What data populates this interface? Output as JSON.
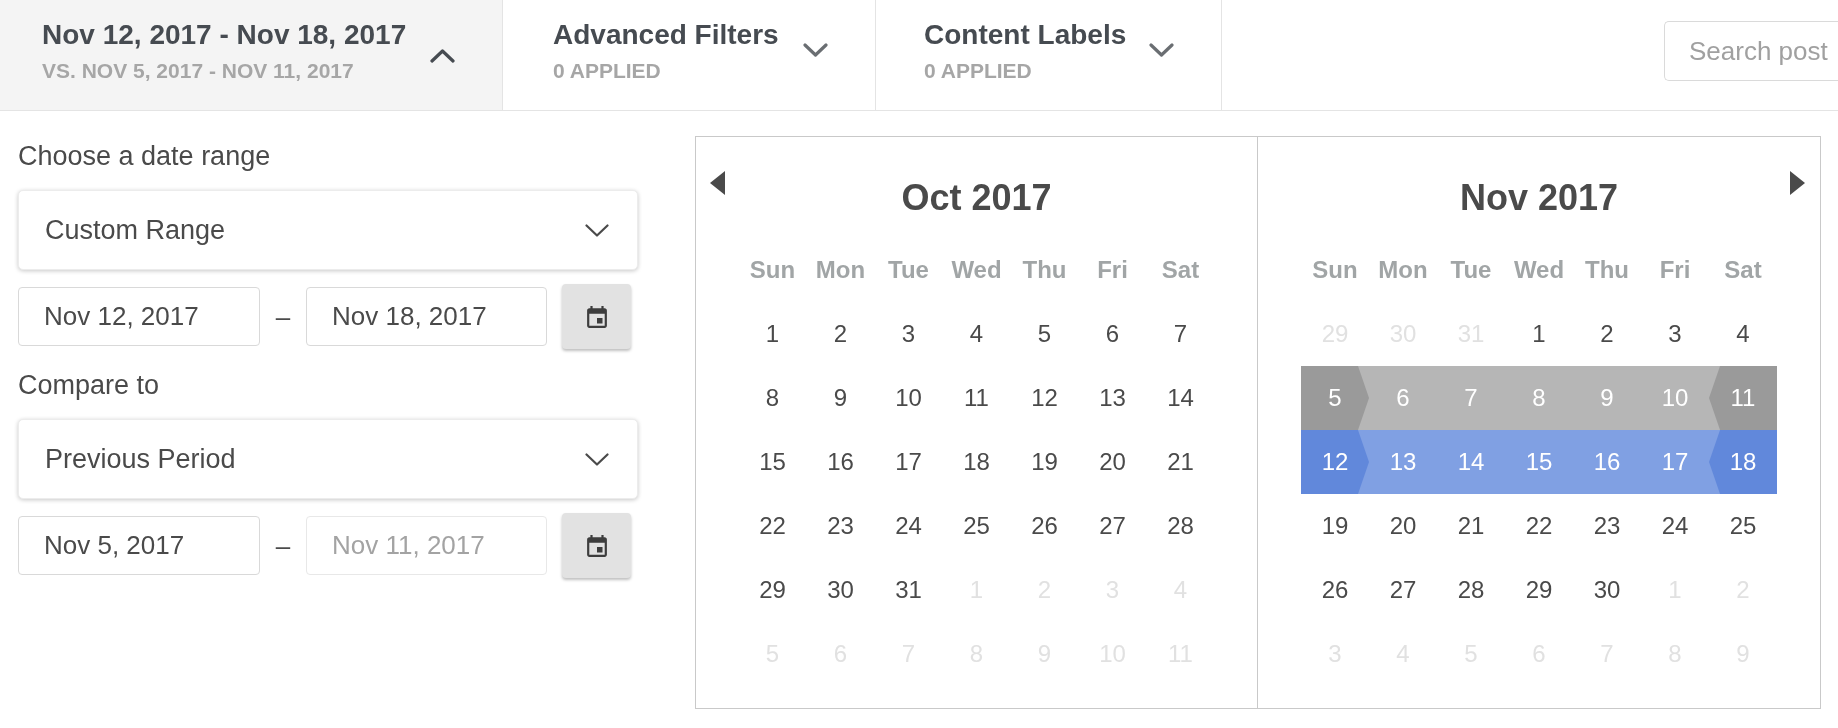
{
  "filter_bar": {
    "tabs": [
      {
        "title": "Nov 12, 2017 - Nov 18, 2017",
        "subtitle": "VS. NOV 5, 2017 - NOV 11, 2017",
        "expanded": true
      },
      {
        "title": "Advanced Filters",
        "subtitle": "0 APPLIED",
        "expanded": false
      },
      {
        "title": "Content Labels",
        "subtitle": "0 APPLIED",
        "expanded": false
      }
    ],
    "search": {
      "placeholder": "Search post"
    }
  },
  "date_panel": {
    "sections": [
      {
        "label": "Choose a date range",
        "dropdown": "Custom Range",
        "start": {
          "value": "Nov 12, 2017",
          "disabled": false
        },
        "separator": "–",
        "end": {
          "value": "Nov 18, 2017",
          "disabled": false
        }
      },
      {
        "label": "Compare to",
        "dropdown": "Previous Period",
        "start": {
          "value": "Nov 5, 2017",
          "disabled": false
        },
        "separator": "–",
        "end": {
          "value": "Nov 11, 2017",
          "disabled": true
        }
      }
    ]
  },
  "calendar": {
    "months": [
      {
        "title": "Oct 2017",
        "weekdays": [
          "Sun",
          "Mon",
          "Tue",
          "Wed",
          "Thu",
          "Fri",
          "Sat"
        ],
        "weeks": [
          [
            {
              "label": "1",
              "other_month": false,
              "selected": false,
              "compared": false
            },
            {
              "label": "2",
              "other_month": false,
              "selected": false,
              "compared": false
            },
            {
              "label": "3",
              "other_month": false,
              "selected": false,
              "compared": false
            },
            {
              "label": "4",
              "other_month": false,
              "selected": false,
              "compared": false
            },
            {
              "label": "5",
              "other_month": false,
              "selected": false,
              "compared": false
            },
            {
              "label": "6",
              "other_month": false,
              "selected": false,
              "compared": false
            },
            {
              "label": "7",
              "other_month": false,
              "selected": false,
              "compared": false
            }
          ],
          [
            {
              "label": "8",
              "other_month": false,
              "selected": false,
              "compared": false
            },
            {
              "label": "9",
              "other_month": false,
              "selected": false,
              "compared": false
            },
            {
              "label": "10",
              "other_month": false,
              "selected": false,
              "compared": false
            },
            {
              "label": "11",
              "other_month": false,
              "selected": false,
              "compared": false
            },
            {
              "label": "12",
              "other_month": false,
              "selected": false,
              "compared": false
            },
            {
              "label": "13",
              "other_month": false,
              "selected": false,
              "compared": false
            },
            {
              "label": "14",
              "other_month": false,
              "selected": false,
              "compared": false
            }
          ],
          [
            {
              "label": "15",
              "other_month": false,
              "selected": false,
              "compared": false
            },
            {
              "label": "16",
              "other_month": false,
              "selected": false,
              "compared": false
            },
            {
              "label": "17",
              "other_month": false,
              "selected": false,
              "compared": false
            },
            {
              "label": "18",
              "other_month": false,
              "selected": false,
              "compared": false
            },
            {
              "label": "19",
              "other_month": false,
              "selected": false,
              "compared": false
            },
            {
              "label": "20",
              "other_month": false,
              "selected": false,
              "compared": false
            },
            {
              "label": "21",
              "other_month": false,
              "selected": false,
              "compared": false
            }
          ],
          [
            {
              "label": "22",
              "other_month": false,
              "selected": false,
              "compared": false
            },
            {
              "label": "23",
              "other_month": false,
              "selected": false,
              "compared": false
            },
            {
              "label": "24",
              "other_month": false,
              "selected": false,
              "compared": false
            },
            {
              "label": "25",
              "other_month": false,
              "selected": false,
              "compared": false
            },
            {
              "label": "26",
              "other_month": false,
              "selected": false,
              "compared": false
            },
            {
              "label": "27",
              "other_month": false,
              "selected": false,
              "compared": false
            },
            {
              "label": "28",
              "other_month": false,
              "selected": false,
              "compared": false
            }
          ],
          [
            {
              "label": "29",
              "other_month": false,
              "selected": false,
              "compared": false
            },
            {
              "label": "30",
              "other_month": false,
              "selected": false,
              "compared": false
            },
            {
              "label": "31",
              "other_month": false,
              "selected": false,
              "compared": false
            },
            {
              "label": "1",
              "other_month": true,
              "selected": false,
              "compared": false
            },
            {
              "label": "2",
              "other_month": true,
              "selected": false,
              "compared": false
            },
            {
              "label": "3",
              "other_month": true,
              "selected": false,
              "compared": false
            },
            {
              "label": "4",
              "other_month": true,
              "selected": false,
              "compared": false
            }
          ],
          [
            {
              "label": "5",
              "other_month": true,
              "selected": false,
              "compared": false
            },
            {
              "label": "6",
              "other_month": true,
              "selected": false,
              "compared": false
            },
            {
              "label": "7",
              "other_month": true,
              "selected": false,
              "compared": false
            },
            {
              "label": "8",
              "other_month": true,
              "selected": false,
              "compared": false
            },
            {
              "label": "9",
              "other_month": true,
              "selected": false,
              "compared": false
            },
            {
              "label": "10",
              "other_month": true,
              "selected": false,
              "compared": false
            },
            {
              "label": "11",
              "other_month": true,
              "selected": false,
              "compared": false
            }
          ]
        ]
      },
      {
        "title": "Nov 2017",
        "weekdays": [
          "Sun",
          "Mon",
          "Tue",
          "Wed",
          "Thu",
          "Fri",
          "Sat"
        ],
        "weeks": [
          [
            {
              "label": "29",
              "other_month": true,
              "selected": false,
              "compared": false
            },
            {
              "label": "30",
              "other_month": true,
              "selected": false,
              "compared": false
            },
            {
              "label": "31",
              "other_month": true,
              "selected": false,
              "compared": false
            },
            {
              "label": "1",
              "other_month": false,
              "selected": false,
              "compared": false
            },
            {
              "label": "2",
              "other_month": false,
              "selected": false,
              "compared": false
            },
            {
              "label": "3",
              "other_month": false,
              "selected": false,
              "compared": false
            },
            {
              "label": "4",
              "other_month": false,
              "selected": false,
              "compared": false
            }
          ],
          [
            {
              "label": "5",
              "other_month": false,
              "selected": false,
              "compared": true
            },
            {
              "label": "6",
              "other_month": false,
              "selected": false,
              "compared": true
            },
            {
              "label": "7",
              "other_month": false,
              "selected": false,
              "compared": true
            },
            {
              "label": "8",
              "other_month": false,
              "selected": false,
              "compared": true
            },
            {
              "label": "9",
              "other_month": false,
              "selected": false,
              "compared": true
            },
            {
              "label": "10",
              "other_month": false,
              "selected": false,
              "compared": true
            },
            {
              "label": "11",
              "other_month": false,
              "selected": false,
              "compared": true
            }
          ],
          [
            {
              "label": "12",
              "other_month": false,
              "selected": true,
              "compared": false
            },
            {
              "label": "13",
              "other_month": false,
              "selected": true,
              "compared": false
            },
            {
              "label": "14",
              "other_month": false,
              "selected": true,
              "compared": false
            },
            {
              "label": "15",
              "other_month": false,
              "selected": true,
              "compared": false
            },
            {
              "label": "16",
              "other_month": false,
              "selected": true,
              "compared": false
            },
            {
              "label": "17",
              "other_month": false,
              "selected": true,
              "compared": false
            },
            {
              "label": "18",
              "other_month": false,
              "selected": true,
              "compared": false
            }
          ],
          [
            {
              "label": "19",
              "other_month": false,
              "selected": false,
              "compared": false
            },
            {
              "label": "20",
              "other_month": false,
              "selected": false,
              "compared": false
            },
            {
              "label": "21",
              "other_month": false,
              "selected": false,
              "compared": false
            },
            {
              "label": "22",
              "other_month": false,
              "selected": false,
              "compared": false
            },
            {
              "label": "23",
              "other_month": false,
              "selected": false,
              "compared": false
            },
            {
              "label": "24",
              "other_month": false,
              "selected": false,
              "compared": false
            },
            {
              "label": "25",
              "other_month": false,
              "selected": false,
              "compared": false
            }
          ],
          [
            {
              "label": "26",
              "other_month": false,
              "selected": false,
              "compared": false
            },
            {
              "label": "27",
              "other_month": false,
              "selected": false,
              "compared": false
            },
            {
              "label": "28",
              "other_month": false,
              "selected": false,
              "compared": false
            },
            {
              "label": "29",
              "other_month": false,
              "selected": false,
              "compared": false
            },
            {
              "label": "30",
              "other_month": false,
              "selected": false,
              "compared": false
            },
            {
              "label": "1",
              "other_month": true,
              "selected": false,
              "compared": false
            },
            {
              "label": "2",
              "other_month": true,
              "selected": false,
              "compared": false
            }
          ],
          [
            {
              "label": "3",
              "other_month": true,
              "selected": false,
              "compared": false
            },
            {
              "label": "4",
              "other_month": true,
              "selected": false,
              "compared": false
            },
            {
              "label": "5",
              "other_month": true,
              "selected": false,
              "compared": false
            },
            {
              "label": "6",
              "other_month": true,
              "selected": false,
              "compared": false
            },
            {
              "label": "7",
              "other_month": true,
              "selected": false,
              "compared": false
            },
            {
              "label": "8",
              "other_month": true,
              "selected": false,
              "compared": false
            },
            {
              "label": "9",
              "other_month": true,
              "selected": false,
              "compared": false
            }
          ]
        ]
      }
    ]
  }
}
